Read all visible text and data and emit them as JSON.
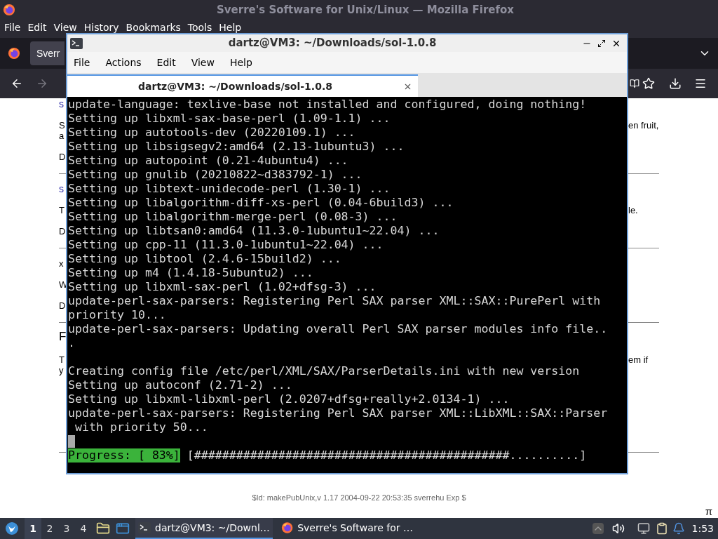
{
  "firefox": {
    "title": "Sverre's Software for Unix/Linux — Mozilla Firefox",
    "menu": [
      "File",
      "Edit",
      "View",
      "History",
      "Bookmarks",
      "Tools",
      "Help"
    ],
    "tab": {
      "label": "Sverr"
    }
  },
  "page": {
    "rows": [
      {
        "kind": "link",
        "left": "s"
      },
      {
        "kind": "para",
        "left": "S",
        "right": "en fruit,"
      },
      {
        "kind": "cont",
        "left": "a"
      },
      {
        "kind": "para",
        "left": "D"
      },
      {
        "kind": "rule"
      },
      {
        "kind": "link",
        "left": "s"
      },
      {
        "kind": "para",
        "left": "T",
        "right": "le."
      },
      {
        "kind": "para",
        "left": "D"
      },
      {
        "kind": "rule"
      },
      {
        "kind": "para",
        "left": "x"
      },
      {
        "kind": "para",
        "left": "W"
      },
      {
        "kind": "para",
        "left": "D"
      },
      {
        "kind": "rule"
      },
      {
        "kind": "heading",
        "left": "F"
      },
      {
        "kind": "para",
        "left": "T",
        "right": "em if"
      },
      {
        "kind": "cont",
        "left": "y"
      },
      {
        "kind": "endrule"
      }
    ],
    "footer": "$Id: makePubUnix,v 1.17 2004-09-22 20:53:35 sverrehu Exp $",
    "corner": "π"
  },
  "terminal": {
    "title": "dartz@VM3: ~/Downloads/sol-1.0.8",
    "menu": [
      "File",
      "Actions",
      "Edit",
      "View",
      "Help"
    ],
    "tabs": [
      {
        "label": "dartz@VM3: ~/Downloads/sol-1.0.8",
        "selected": true
      }
    ],
    "lines": [
      {
        "kind": "text",
        "text": "update-language: texlive-base not installed and configured, doing nothing!"
      },
      {
        "kind": "text",
        "text": "Setting up libxml-sax-base-perl (1.09-1.1) ..."
      },
      {
        "kind": "text",
        "text": "Setting up autotools-dev (20220109.1) ..."
      },
      {
        "kind": "text",
        "text": "Setting up libsigsegv2:amd64 (2.13-1ubuntu3) ..."
      },
      {
        "kind": "text",
        "text": "Setting up autopoint (0.21-4ubuntu4) ..."
      },
      {
        "kind": "text",
        "text": "Setting up gnulib (20210822~d383792-1) ..."
      },
      {
        "kind": "text",
        "text": "Setting up libtext-unidecode-perl (1.30-1) ..."
      },
      {
        "kind": "text",
        "text": "Setting up libalgorithm-diff-xs-perl (0.04-6build3) ..."
      },
      {
        "kind": "text",
        "text": "Setting up libalgorithm-merge-perl (0.08-3) ..."
      },
      {
        "kind": "text",
        "text": "Setting up libtsan0:amd64 (11.3.0-1ubuntu1~22.04) ..."
      },
      {
        "kind": "text",
        "text": "Setting up cpp-11 (11.3.0-1ubuntu1~22.04) ..."
      },
      {
        "kind": "text",
        "text": "Setting up libtool (2.4.6-15build2) ..."
      },
      {
        "kind": "text",
        "text": "Setting up m4 (1.4.18-5ubuntu2) ..."
      },
      {
        "kind": "text",
        "text": "Setting up libxml-sax-perl (1.02+dfsg-3) ..."
      },
      {
        "kind": "text",
        "text": "update-perl-sax-parsers: Registering Perl SAX parser XML::SAX::PurePerl with"
      },
      {
        "kind": "text",
        "text": "priority 10..."
      },
      {
        "kind": "text",
        "text": "update-perl-sax-parsers: Updating overall Perl SAX parser modules info file.."
      },
      {
        "kind": "text",
        "text": "."
      },
      {
        "kind": "blank"
      },
      {
        "kind": "text",
        "text": "Creating config file /etc/perl/XML/SAX/ParserDetails.ini with new version"
      },
      {
        "kind": "text",
        "text": "Setting up autoconf (2.71-2) ..."
      },
      {
        "kind": "text",
        "text": "Setting up libxml-libxml-perl (2.0207+dfsg+really+2.0134-1) ..."
      },
      {
        "kind": "text",
        "text": "update-perl-sax-parsers: Registering Perl SAX parser XML::LibXML::SAX::Parser"
      },
      {
        "kind": "text",
        "text": " with priority 50..."
      },
      {
        "kind": "cursor"
      }
    ],
    "progress": {
      "label": "Progress: [ 83%]",
      "bar": "[#############################################..........]"
    }
  },
  "taskbar": {
    "workspaces": [
      {
        "label": "1",
        "selected": true
      },
      {
        "label": "2",
        "selected": false
      },
      {
        "label": "3",
        "selected": false
      },
      {
        "label": "4",
        "selected": false
      }
    ],
    "tasks": [
      {
        "kind": "terminal",
        "label": "dartz@VM3: ~/Downl…",
        "selected": true
      },
      {
        "kind": "browser",
        "label": "Sverre's Software for …",
        "selected": false
      }
    ],
    "clock": "1:53"
  }
}
